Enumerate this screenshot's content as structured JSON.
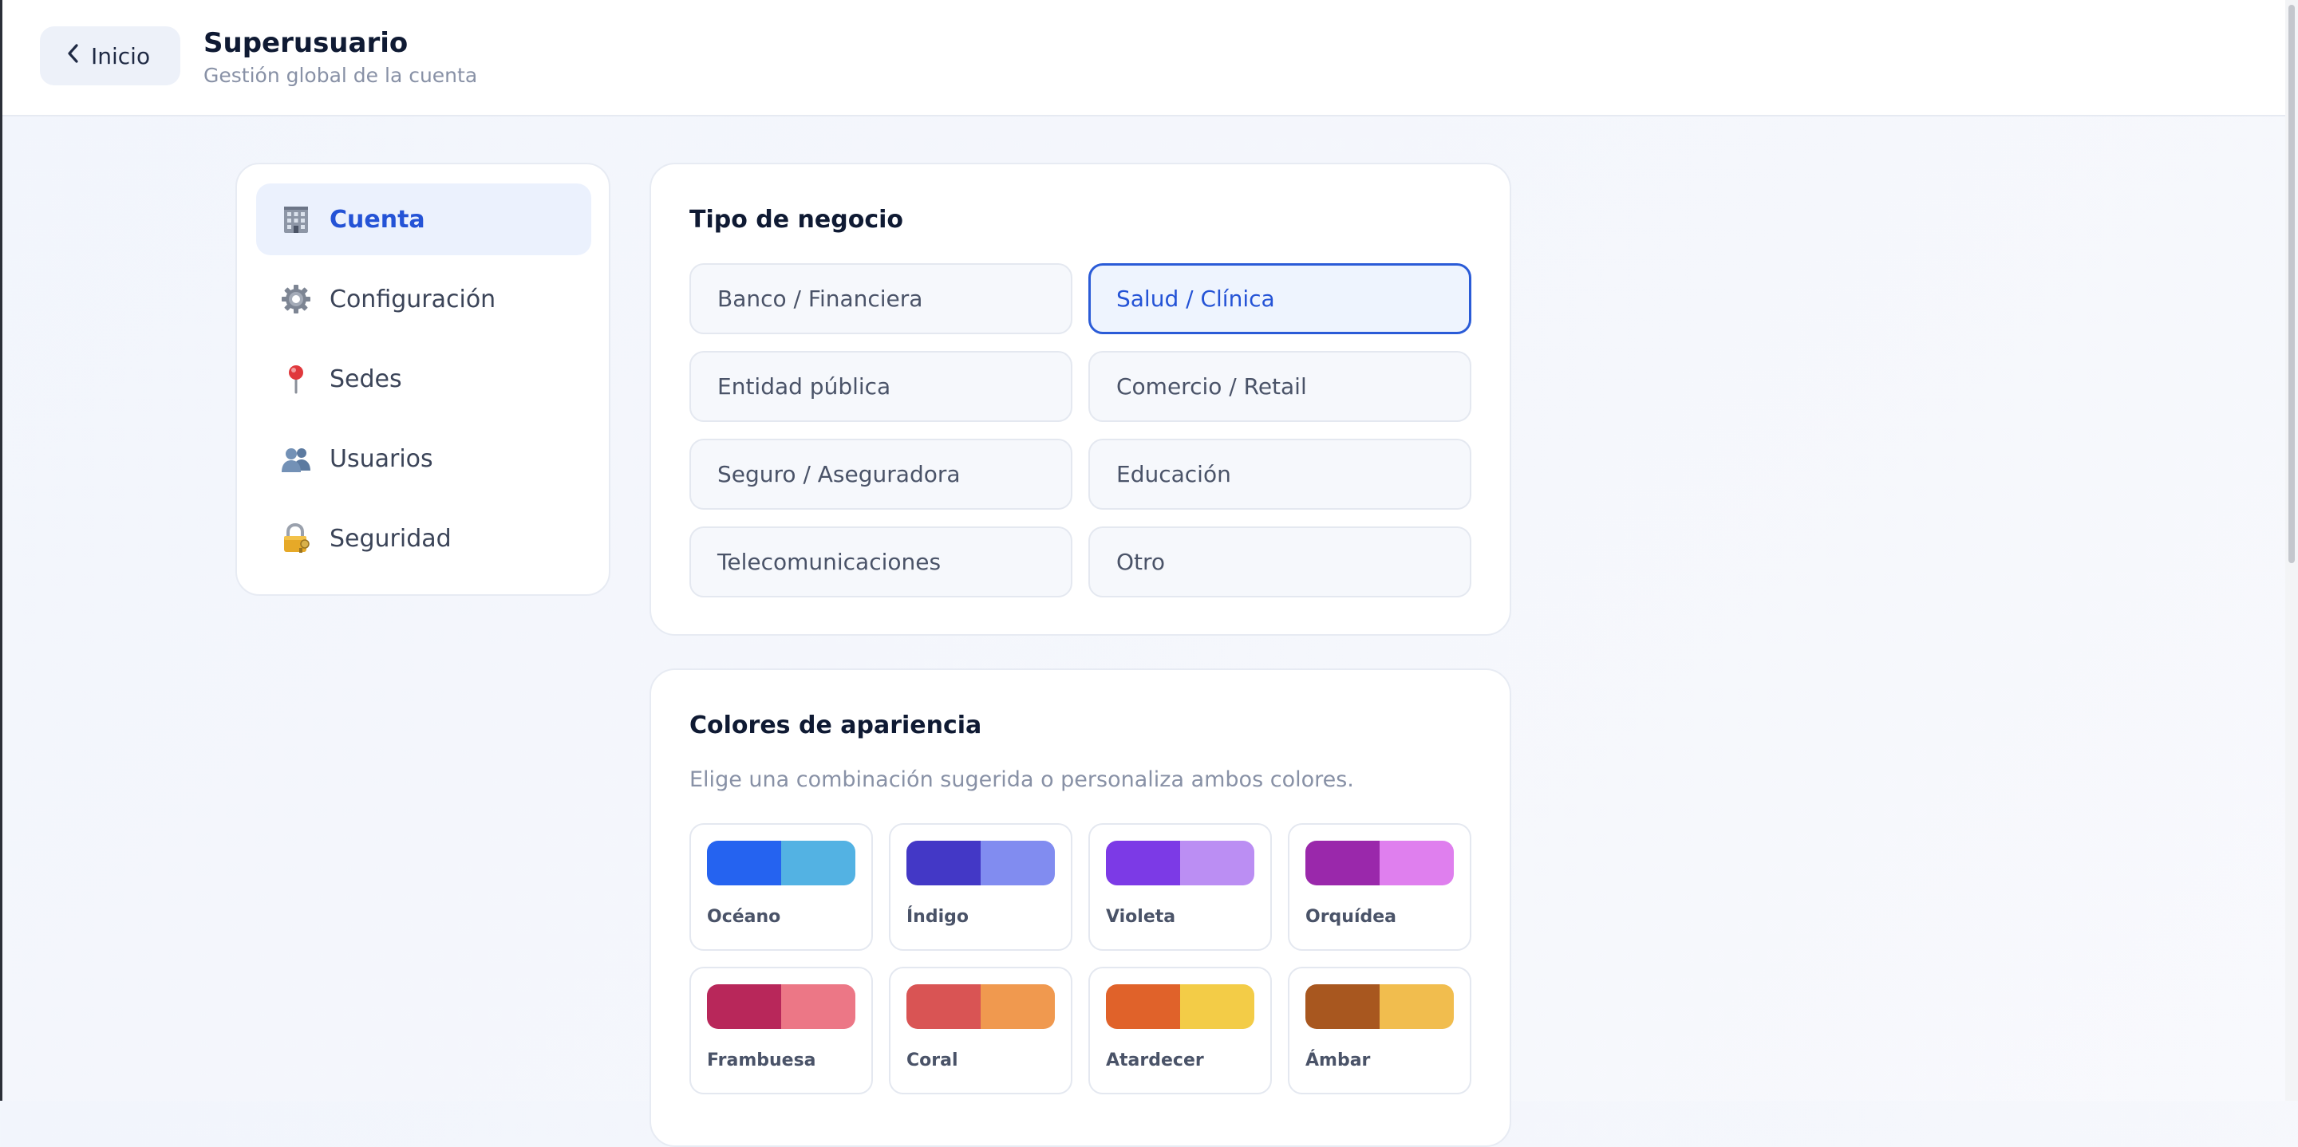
{
  "header": {
    "back_label": "Inicio",
    "title": "Superusuario",
    "subtitle": "Gestión global de la cuenta"
  },
  "sidebar": {
    "items": [
      {
        "label": "Cuenta",
        "icon": "building-icon",
        "active": true
      },
      {
        "label": "Configuración",
        "icon": "gear-icon",
        "active": false
      },
      {
        "label": "Sedes",
        "icon": "pin-icon",
        "active": false
      },
      {
        "label": "Usuarios",
        "icon": "users-icon",
        "active": false
      },
      {
        "label": "Seguridad",
        "icon": "lock-icon",
        "active": false
      }
    ]
  },
  "business_type": {
    "title": "Tipo de negocio",
    "selected": "Salud / Clínica",
    "options": [
      "Banco / Financiera",
      "Salud / Clínica",
      "Entidad pública",
      "Comercio / Retail",
      "Seguro / Aseguradora",
      "Educación",
      "Telecomunicaciones",
      "Otro"
    ]
  },
  "appearance": {
    "title": "Colores de apariencia",
    "description": "Elige una combinación sugerida o personaliza ambos colores.",
    "palettes": [
      {
        "name": "Océano",
        "primary": "#2563f0",
        "secondary": "#53b2e3"
      },
      {
        "name": "Índigo",
        "primary": "#4338c6",
        "secondary": "#818cf0"
      },
      {
        "name": "Violeta",
        "primary": "#7c3ae6",
        "secondary": "#bb8ef3"
      },
      {
        "name": "Orquídea",
        "primary": "#9a28ab",
        "secondary": "#df7fee"
      },
      {
        "name": "Frambuesa",
        "primary": "#b8275a",
        "secondary": "#ec7786"
      },
      {
        "name": "Coral",
        "primary": "#d95454",
        "secondary": "#f0994f"
      },
      {
        "name": "Atardecer",
        "primary": "#e0622a",
        "secondary": "#f3cc47"
      },
      {
        "name": "Ámbar",
        "primary": "#a8571f",
        "secondary": "#f1bd4e"
      }
    ]
  },
  "colors": {
    "accent": "#2453d6",
    "selected_border": "#2a5bd7",
    "selected_bg": "#eef4fe"
  }
}
